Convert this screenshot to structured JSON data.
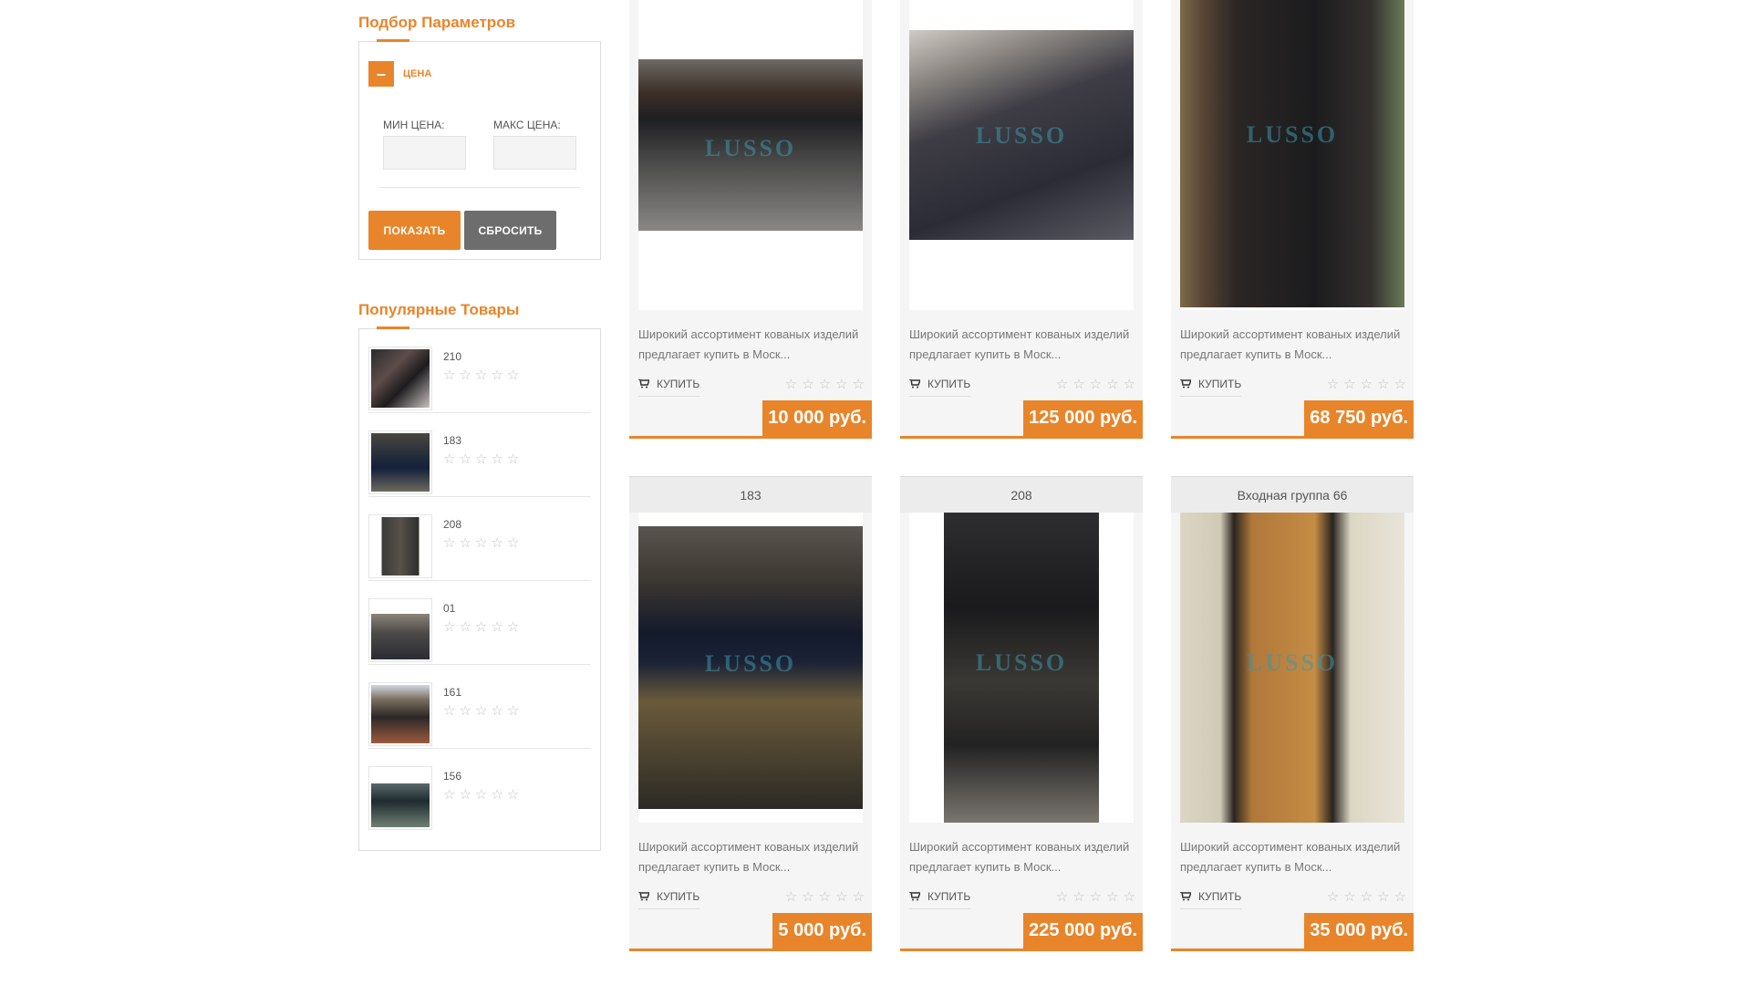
{
  "filter": {
    "title": "Подбор Параметров",
    "toggle_icon": "–",
    "section_label": "ЦЕНА",
    "min_label": "МИН ЦЕНА:",
    "max_label": "МАКС ЦЕНА:",
    "min_value": "",
    "max_value": "",
    "show_label": "ПОКАЗАТЬ",
    "reset_label": "СБРОСИТЬ"
  },
  "popular": {
    "title": "Популярные Товары",
    "items": [
      {
        "name": "210"
      },
      {
        "name": "183"
      },
      {
        "name": "208"
      },
      {
        "name": "01"
      },
      {
        "name": "161"
      },
      {
        "name": "156"
      }
    ]
  },
  "star_glyph": "☆",
  "products": [
    {
      "title": "",
      "desc": "Широкий ассортимент кованых изделий предлагает купить в Моск...",
      "buy": "КУПИТЬ",
      "price": "10 000 руб.",
      "watermark": "LUSSO"
    },
    {
      "title": "",
      "desc": "Широкий ассортимент кованых изделий предлагает купить в Моск...",
      "buy": "КУПИТЬ",
      "price": "125 000 руб.",
      "watermark": "LUSSO"
    },
    {
      "title": "",
      "desc": "Широкий ассортимент кованых изделий предлагает купить в Моск...",
      "buy": "КУПИТЬ",
      "price": "68 750 руб.",
      "watermark": "LUSSO"
    },
    {
      "title": "183",
      "desc": "Широкий ассортимент кованых изделий предлагает купить в Моск...",
      "buy": "КУПИТЬ",
      "price": "5 000 руб.",
      "watermark": "LUSSO"
    },
    {
      "title": "208",
      "desc": "Широкий ассортимент кованых изделий предлагает купить в Моск...",
      "buy": "КУПИТЬ",
      "price": "225 000 руб.",
      "watermark": "LUSSO"
    },
    {
      "title": "Входная группа 66",
      "desc": "Широкий ассортимент кованых изделий предлагает купить в Моск...",
      "buy": "КУПИТЬ",
      "price": "35 000 руб.",
      "watermark": "LUSSO"
    }
  ],
  "colors": {
    "accent": "#e8852a",
    "reset_button": "#6d6d6d",
    "card_bg": "#f5f5f5"
  }
}
